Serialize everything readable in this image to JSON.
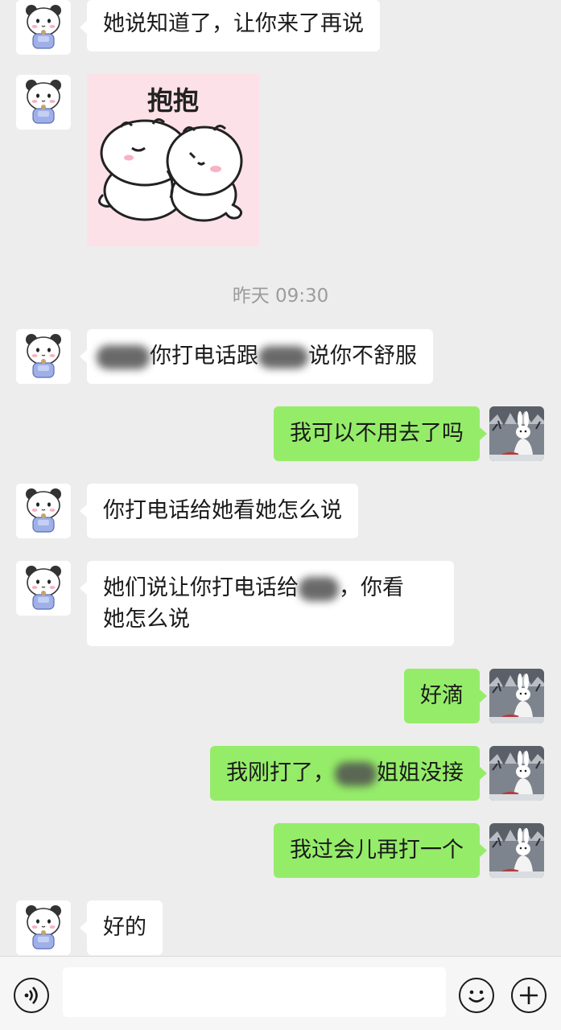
{
  "timestamp": "昨天 09:30",
  "sticker": {
    "label": "抱抱"
  },
  "messages": {
    "m1": {
      "text": "她说知道了，让你来了再说"
    },
    "m3": {
      "text_a": "你打电话跟",
      "text_b": "说你不舒服"
    },
    "m4": {
      "text": "我可以不用去了吗"
    },
    "m5": {
      "text": "你打电话给她看她怎么说"
    },
    "m6": {
      "text_a": "她们说让你打电话给",
      "text_b": "，你看",
      "text_c": "她怎么说"
    },
    "m7": {
      "text": "好滴"
    },
    "m8": {
      "text_a": "我刚打了，",
      "text_b": "姐姐没接"
    },
    "m9": {
      "text": "我过会儿再打一个"
    },
    "m10": {
      "text": "好的"
    }
  },
  "input_bar": {
    "voice_icon": "voice-icon",
    "emoji_icon": "emoji-icon",
    "add_icon": "plus-icon",
    "value": ""
  }
}
